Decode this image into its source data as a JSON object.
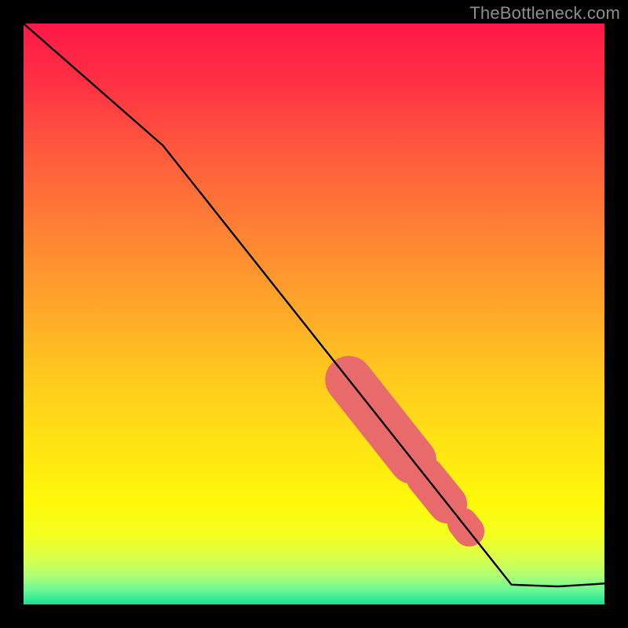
{
  "watermark": "TheBottleneck.com",
  "colors": {
    "gradient_stops": [
      {
        "offset": 0.0,
        "color": "#ff1846"
      },
      {
        "offset": 0.1,
        "color": "#ff3043"
      },
      {
        "offset": 0.22,
        "color": "#ff5a3c"
      },
      {
        "offset": 0.35,
        "color": "#ff8034"
      },
      {
        "offset": 0.48,
        "color": "#ffa42a"
      },
      {
        "offset": 0.6,
        "color": "#ffc71e"
      },
      {
        "offset": 0.72,
        "color": "#ffe313"
      },
      {
        "offset": 0.82,
        "color": "#fff80a"
      },
      {
        "offset": 0.88,
        "color": "#f4ff1e"
      },
      {
        "offset": 0.92,
        "color": "#d9ff4a"
      },
      {
        "offset": 0.95,
        "color": "#b0ff73"
      },
      {
        "offset": 0.975,
        "color": "#6cf896"
      },
      {
        "offset": 1.0,
        "color": "#17e091"
      }
    ],
    "line": "#000000",
    "highlight": "#e86a6a"
  },
  "chart_data": {
    "type": "line",
    "title": "",
    "xlabel": "",
    "ylabel": "",
    "xlim": [
      0,
      100
    ],
    "ylim": [
      0,
      100
    ],
    "line_points": [
      {
        "x": 0.0,
        "y": 100.0
      },
      {
        "x": 24.0,
        "y": 79.0
      },
      {
        "x": 84.0,
        "y": 3.4
      },
      {
        "x": 92.0,
        "y": 3.1
      },
      {
        "x": 100.0,
        "y": 3.6
      }
    ],
    "highlight_segments": [
      {
        "x1": 56.0,
        "y1": 38.7,
        "x2": 67.0,
        "y2": 24.8,
        "w": 3.4
      },
      {
        "x1": 69.2,
        "y1": 22.0,
        "x2": 73.0,
        "y2": 17.3,
        "w": 2.8
      },
      {
        "x1": 75.6,
        "y1": 14.0,
        "x2": 76.7,
        "y2": 12.6,
        "w": 2.2
      }
    ]
  }
}
